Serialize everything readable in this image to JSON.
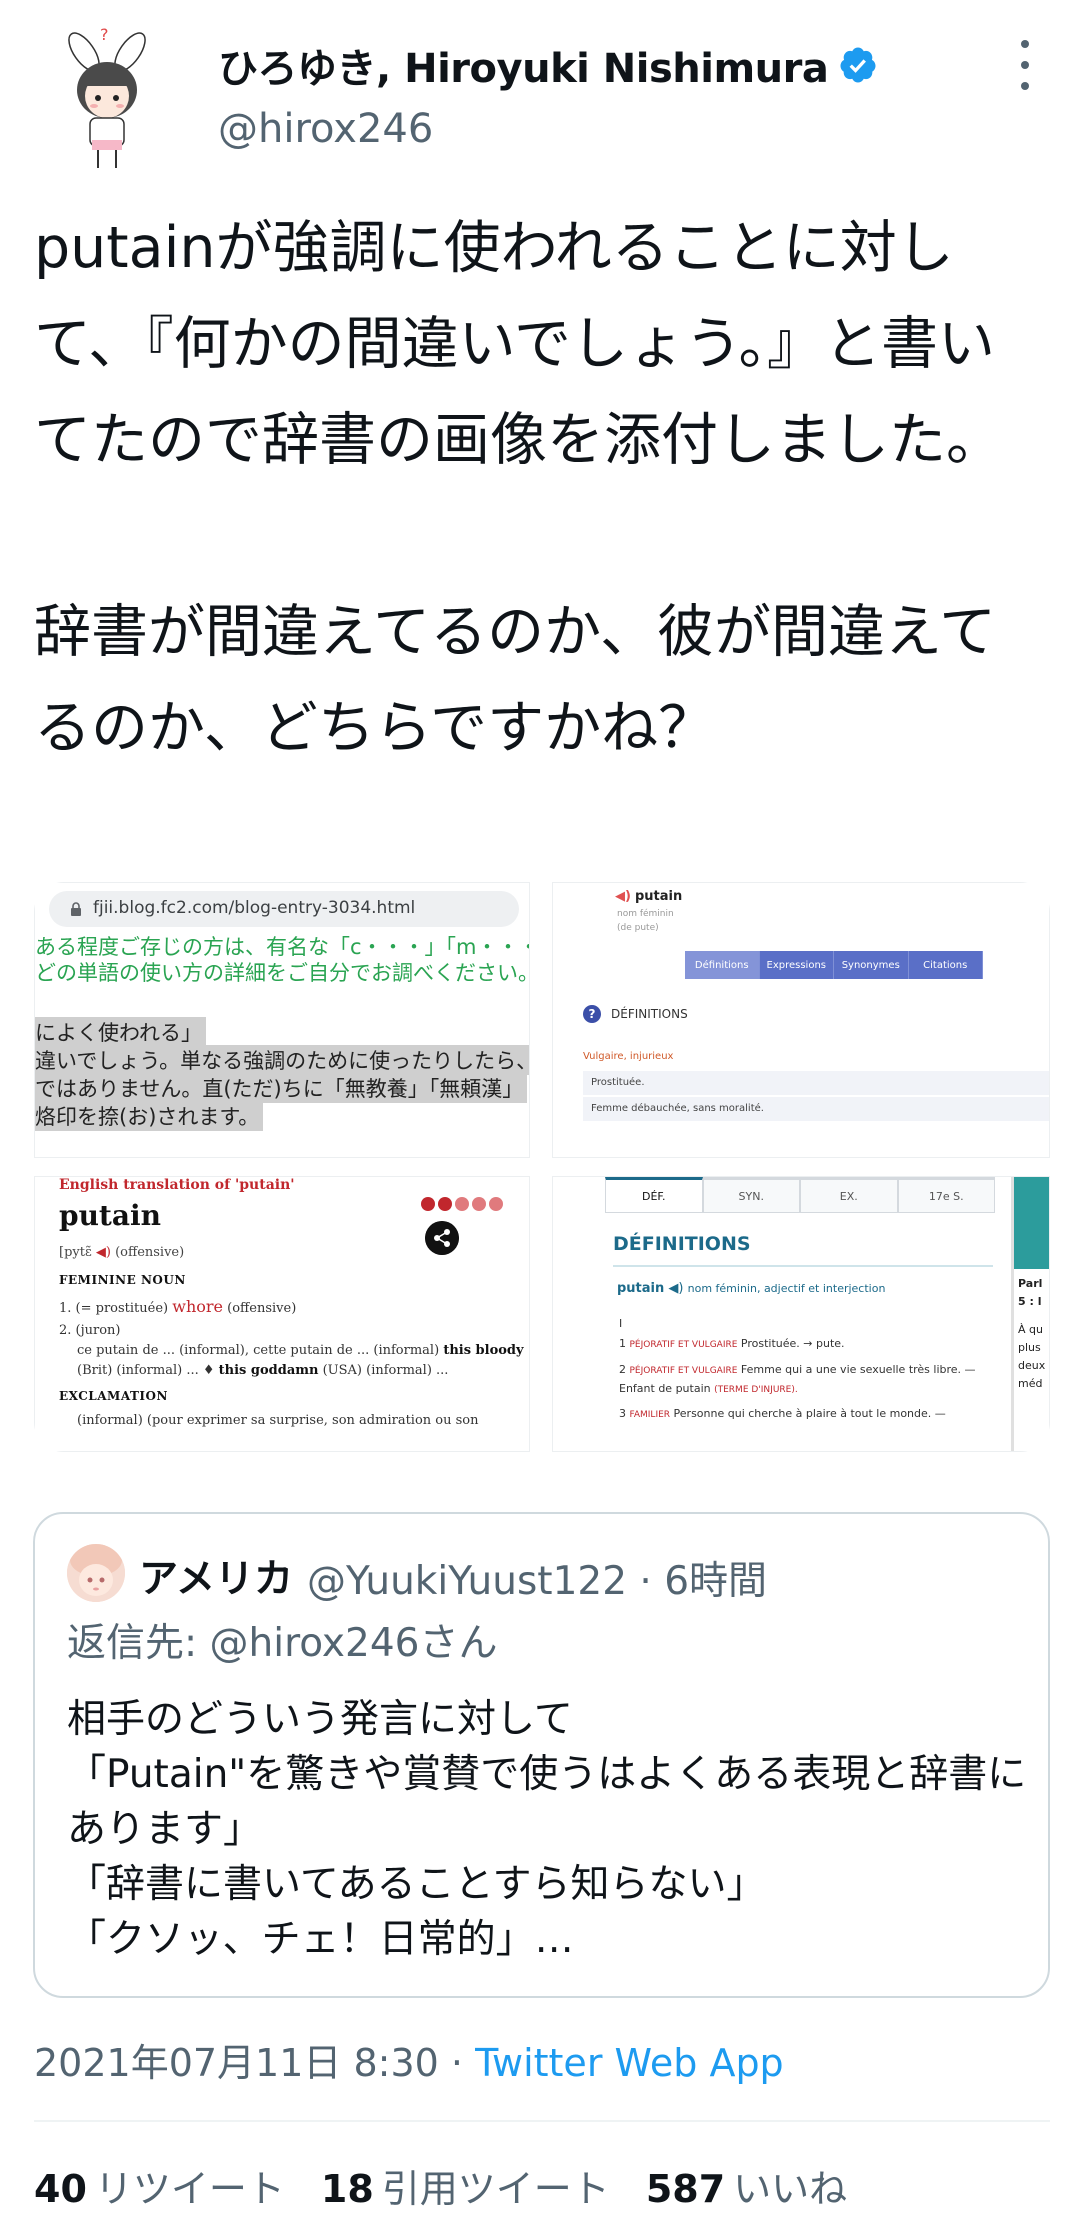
{
  "author": {
    "display_name": "ひろゆき, Hiroyuki Nishimura",
    "handle": "@hirox246"
  },
  "tweet": {
    "text": "putainが強調に使われることに対して、『何かの間違いでしょう。』と書いてたので辞書の画像を添付しました。\n\n辞書が間違えてるのか、彼が間違えてるのか、どちらですかね？"
  },
  "media": {
    "blog": {
      "url": "fjii.blog.fc2.com/blog-entry-3034.html",
      "green_lines": [
        "ある程度ご存じの方は、有名な「c・・・」「m・・・",
        "どの単語の使い方の詳細をご自分でお調べください。"
      ],
      "gray_lines": [
        "によく使われる」",
        "違いでしょう。単なる強調のために使ったりしたら、",
        "ではありません。直(ただ)ちに「無教養」「無頼漢」",
        "烙印を捺(お)されます。"
      ]
    },
    "larousse_online": {
      "word": "putain",
      "sub1": "nom féminin",
      "sub2": "(de pute)",
      "tabs": [
        "Définitions",
        "Expressions",
        "Synonymes",
        "Citations"
      ],
      "heading": "DÉFINITIONS",
      "label": "Vulgaire, injurieux",
      "def1": "Prostituée.",
      "def2": "Femme débauchée, sans moralité."
    },
    "collins": {
      "caption": "English translation of 'putain'",
      "word": "putain",
      "pron": "[pytɛ̃",
      "pron_tag": "(offensive)",
      "head1": "FEMININE NOUN",
      "l1_pre": "1.  (= prostituée)",
      "l1_word": "whore",
      "l1_post": "(offensive)",
      "l2": "2.  (juron)",
      "l3_pre": "ce putain de ... (informal), cette putain de ... (informal)",
      "l3_bold": "this bloody",
      "l4_pre": "(Brit) (informal) ... ♦",
      "l4_bold": "this goddamn",
      "l4_post": "(USA) (informal) ...",
      "head2": "EXCLAMATION",
      "l5": "(informal) (pour exprimer sa surprise, son admiration ou son",
      "dot_colors": [
        "#c1272d",
        "#c1272d",
        "#e07a7d",
        "#e07a7d",
        "#e07a7d"
      ]
    },
    "larousse_print": {
      "tabs": [
        "DÉF.",
        "SYN.",
        "EX.",
        "17e S."
      ],
      "title": "DÉFINITIONS",
      "entry_word": "putain",
      "entry_rest": "nom féminin, adjectif et interjection",
      "roman": "I",
      "d1_tag": "PÉJORATIF ET VULGAIRE",
      "d1": "Prostituée. → pute.",
      "d2_tag": "PÉJORATIF ET VULGAIRE",
      "d2": "Femme qui a une vie sexuelle très libre. — Enfant de putain",
      "d2_tail": "(TERME D'INJURE).",
      "d3_tag": "FAMILIER",
      "d3": "Personne qui cherche à plaire à tout le monde. —",
      "side_title": "Parl",
      "side_2": "5 : l",
      "side_lines": [
        "À qu",
        "plus",
        "deux",
        "méd"
      ]
    }
  },
  "quote": {
    "name": "アメリカ",
    "handle_time": "@YuukiYuust122 · 6時間",
    "reply_to": "返信先: @hirox246さん",
    "text": "相手のどういう発言に対して\n「Putain\"を驚きや賞賛で使うはよくある表現と辞書にあります」\n「辞書に書いてあることすら知らない」\n「クソッ、チェ！日常的」…"
  },
  "footer": {
    "timestamp": "2021年07月11日 8:30 · ",
    "app": "Twitter Web App",
    "retweets_count": "40",
    "retweets_label": "リツイート",
    "quotes_count": "18",
    "quotes_label": "引用ツイート",
    "likes_count": "587",
    "likes_label": "いいね"
  },
  "colors": {
    "verified": "#1d9bf0",
    "link": "#1d9bf0",
    "secondary_text": "#536471"
  }
}
